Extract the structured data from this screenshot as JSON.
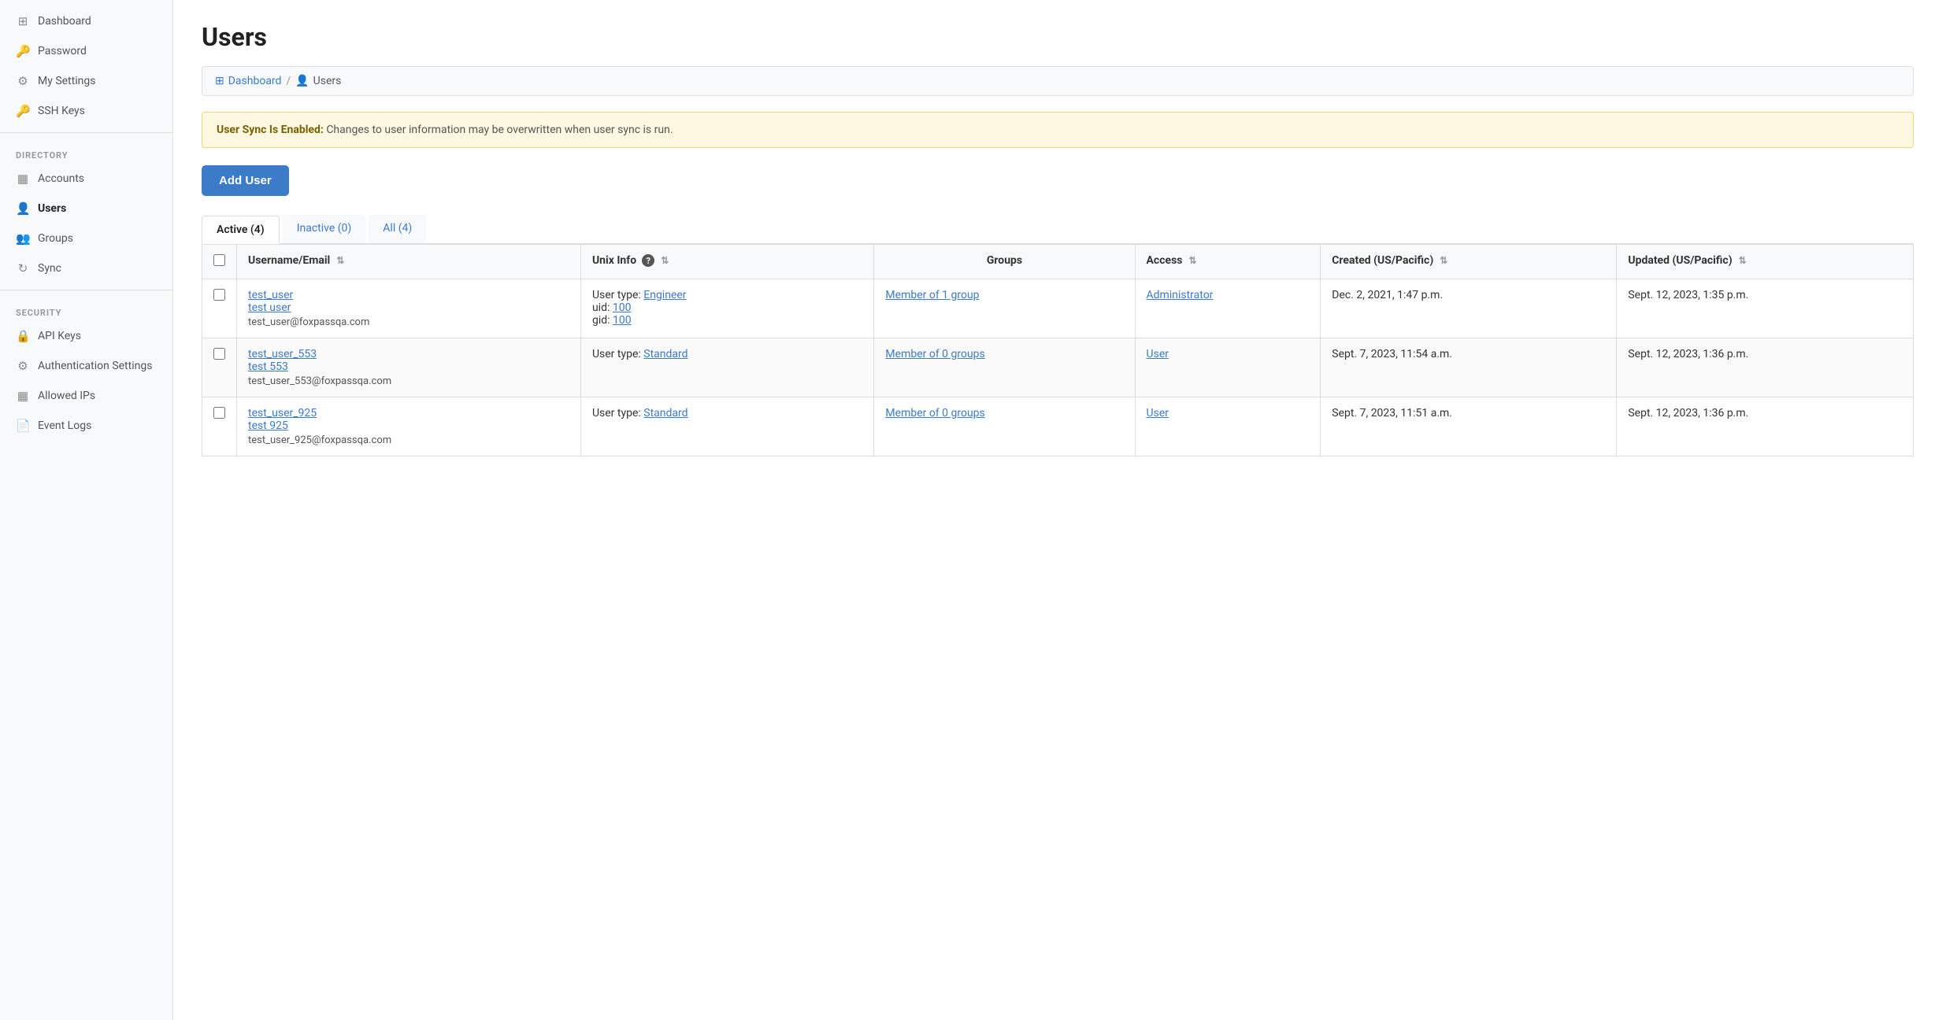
{
  "sidebar": {
    "items": [
      {
        "id": "dashboard",
        "label": "Dashboard",
        "icon": "⊞",
        "active": false
      },
      {
        "id": "password",
        "label": "Password",
        "icon": "🔑",
        "active": false
      },
      {
        "id": "my-settings",
        "label": "My Settings",
        "icon": "⚙",
        "active": false
      },
      {
        "id": "ssh-keys",
        "label": "SSH Keys",
        "icon": "🔑",
        "active": false
      }
    ],
    "sections": [
      {
        "label": "DIRECTORY",
        "items": [
          {
            "id": "accounts",
            "label": "Accounts",
            "icon": "▦",
            "active": false
          },
          {
            "id": "users",
            "label": "Users",
            "icon": "👤",
            "active": true
          },
          {
            "id": "groups",
            "label": "Groups",
            "icon": "👥",
            "active": false
          },
          {
            "id": "sync",
            "label": "Sync",
            "icon": "↻",
            "active": false
          }
        ]
      },
      {
        "label": "SECURITY",
        "items": [
          {
            "id": "api-keys",
            "label": "API Keys",
            "icon": "🔒",
            "active": false
          },
          {
            "id": "auth-settings",
            "label": "Authentication Settings",
            "icon": "⚙",
            "active": false
          },
          {
            "id": "allowed-ips",
            "label": "Allowed IPs",
            "icon": "▦",
            "active": false
          },
          {
            "id": "event-logs",
            "label": "Event Logs",
            "icon": "📄",
            "active": false
          }
        ]
      }
    ]
  },
  "page": {
    "title": "Users",
    "breadcrumb": {
      "home": "Dashboard",
      "current": "Users"
    }
  },
  "alert": {
    "bold": "User Sync Is Enabled:",
    "text": " Changes to user information may be overwritten when user sync is run."
  },
  "add_user_button": "Add User",
  "tabs": [
    {
      "id": "active",
      "label": "Active (4)",
      "active": true
    },
    {
      "id": "inactive",
      "label": "Inactive (0)",
      "active": false
    },
    {
      "id": "all",
      "label": "All (4)",
      "active": false
    }
  ],
  "table": {
    "headers": [
      {
        "id": "username",
        "label": "Username/Email",
        "sortable": true
      },
      {
        "id": "unix",
        "label": "Unix Info",
        "sortable": true,
        "help": true
      },
      {
        "id": "groups",
        "label": "Groups",
        "sortable": false
      },
      {
        "id": "access",
        "label": "Access",
        "sortable": true
      },
      {
        "id": "created",
        "label": "Created (US/Pacific)",
        "sortable": true
      },
      {
        "id": "updated",
        "label": "Updated (US/Pacific)",
        "sortable": true
      }
    ],
    "rows": [
      {
        "id": "row1",
        "username": "test_user",
        "fullname": "test user",
        "email": "test_user@foxpassqa.com",
        "unix_type_label": "User type:",
        "unix_type_value": "Engineer",
        "unix_uid_label": "uid:",
        "unix_uid_value": "100",
        "unix_gid_label": "gid:",
        "unix_gid_value": "100",
        "groups": "Member of 1 group",
        "access": "Administrator",
        "created": "Dec. 2, 2021, 1:47 p.m.",
        "updated": "Sept. 12, 2023, 1:35 p.m."
      },
      {
        "id": "row2",
        "username": "test_user_553",
        "fullname": "test 553",
        "email": "test_user_553@foxpassqa.com",
        "unix_type_label": "User type:",
        "unix_type_value": "Standard",
        "unix_uid_label": "",
        "unix_uid_value": "",
        "unix_gid_label": "",
        "unix_gid_value": "",
        "groups": "Member of 0 groups",
        "access": "User",
        "created": "Sept. 7, 2023, 11:54 a.m.",
        "updated": "Sept. 12, 2023, 1:36 p.m."
      },
      {
        "id": "row3",
        "username": "test_user_925",
        "fullname": "test 925",
        "email": "test_user_925@foxpassqa.com",
        "unix_type_label": "User type:",
        "unix_type_value": "Standard",
        "unix_uid_label": "",
        "unix_uid_value": "",
        "unix_gid_label": "",
        "unix_gid_value": "",
        "groups": "Member of 0 groups",
        "access": "User",
        "created": "Sept. 7, 2023, 11:51 a.m.",
        "updated": "Sept. 12, 2023, 1:36 p.m."
      }
    ]
  }
}
